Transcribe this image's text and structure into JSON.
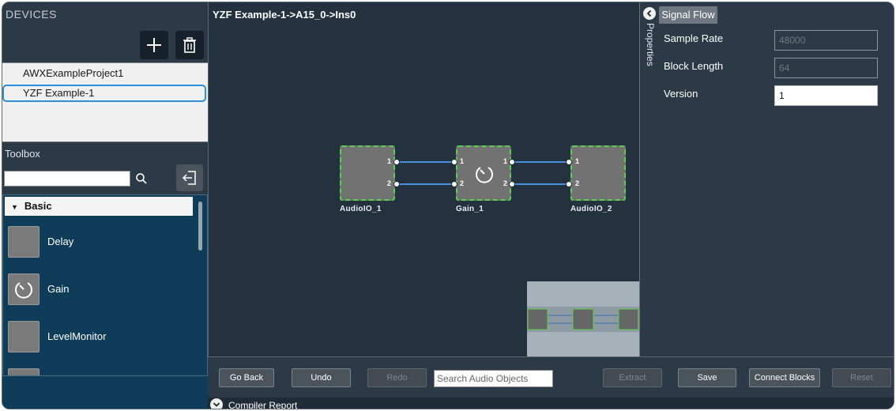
{
  "devices": {
    "title": "DEVICES",
    "items": [
      {
        "label": "AWXExampleProject1",
        "selected": false
      },
      {
        "label": "YZF Example-1",
        "selected": true
      }
    ],
    "add_icon": "plus-icon",
    "delete_icon": "trash-icon"
  },
  "toolbox": {
    "title": "Toolbox",
    "search_value": "",
    "search_icon": "search-icon",
    "import_icon": "import-icon",
    "category": "Basic",
    "items": [
      {
        "label": "Delay",
        "icon": "blank-block-icon"
      },
      {
        "label": "Gain",
        "icon": "gain-dial-icon"
      },
      {
        "label": "LevelMonitor",
        "icon": "blank-block-icon"
      }
    ]
  },
  "canvas": {
    "breadcrumb": "YZF Example-1->A15_0->Ins0",
    "blocks": [
      {
        "label": "AudioIO_1",
        "ports_out": [
          "1",
          "2"
        ]
      },
      {
        "label": "Gain_1",
        "ports_in": [
          "1",
          "2"
        ],
        "ports_out": [
          "1",
          "2"
        ]
      },
      {
        "label": "AudioIO_2",
        "ports_in": [
          "1",
          "2"
        ]
      }
    ],
    "accent": "#5ad14a",
    "wire_color": "#4a8fe0"
  },
  "properties": {
    "vertical_tab": "Properties",
    "tab": "Signal Flow",
    "sample_rate_label": "Sample Rate",
    "sample_rate_value": "48000",
    "block_length_label": "Block Length",
    "block_length_value": "64",
    "version_label": "Version",
    "version_value": "1"
  },
  "toolbar": {
    "go_back": "Go Back",
    "undo": "Undo",
    "redo": "Redo",
    "search_placeholder": "Search Audio Objects",
    "extract": "Extract",
    "save": "Save",
    "connect": "Connect Blocks",
    "reset": "Reset"
  },
  "compiler": {
    "label": "Compiler Report"
  }
}
